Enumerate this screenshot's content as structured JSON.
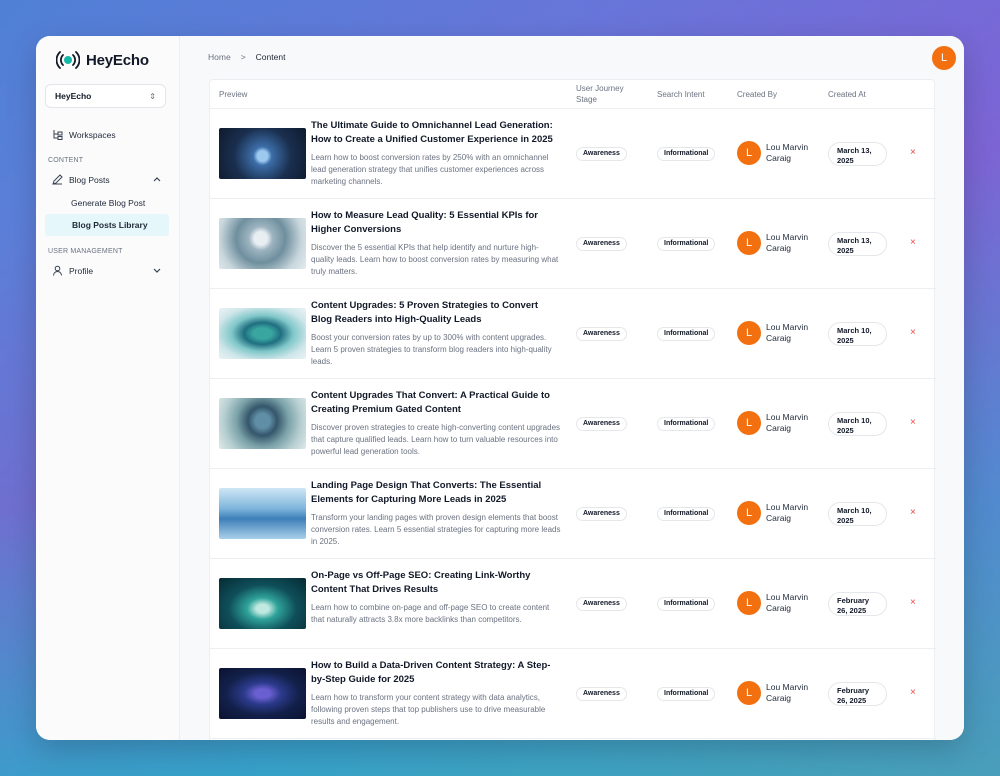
{
  "app": {
    "name": "HeyEcho",
    "brand_color": "#16b8a6",
    "accent_color": "#f2700f"
  },
  "sidebar": {
    "workspace_select": "HeyEcho",
    "workspaces_label": "Workspaces",
    "content_section": "CONTENT",
    "blog_posts_label": "Blog Posts",
    "generate_label": "Generate Blog Post",
    "library_label": "Blog Posts Library",
    "user_section": "USER MANAGEMENT",
    "profile_label": "Profile"
  },
  "breadcrumb": {
    "home": "Home",
    "separator": ">",
    "current": "Content"
  },
  "user_avatar": "L",
  "table": {
    "headers": {
      "preview": "Preview",
      "stage": "User Journey Stage",
      "intent": "Search Intent",
      "created_by": "Created By",
      "created_at": "Created At"
    },
    "rows": [
      {
        "title": "The Ultimate Guide to Omnichannel Lead Generation: How to Create a Unified Customer Experience in 2025",
        "desc": "Learn how to boost conversion rates by 250% with an omnichannel lead generation strategy that unifies customer experiences across marketing channels.",
        "stage": "Awareness",
        "intent": "Informational",
        "avatar": "L",
        "author": "Lou Marvin Caraig",
        "date": "March 13, 2025",
        "delete": "×"
      },
      {
        "title": "How to Measure Lead Quality: 5 Essential KPIs for Higher Conversions",
        "desc": "Discover the 5 essential KPIs that help identify and nurture high-quality leads. Learn how to boost conversion rates by measuring what truly matters.",
        "stage": "Awareness",
        "intent": "Informational",
        "avatar": "L",
        "author": "Lou Marvin Caraig",
        "date": "March 13, 2025",
        "delete": "×"
      },
      {
        "title": "Content Upgrades: 5 Proven Strategies to Convert Blog Readers into High-Quality Leads",
        "desc": "Boost your conversion rates by up to 300% with content upgrades. Learn 5 proven strategies to transform blog readers into high-quality leads.",
        "stage": "Awareness",
        "intent": "Informational",
        "avatar": "L",
        "author": "Lou Marvin Caraig",
        "date": "March 10, 2025",
        "delete": "×"
      },
      {
        "title": "Content Upgrades That Convert: A Practical Guide to Creating Premium Gated Content",
        "desc": "Discover proven strategies to create high-converting content upgrades that capture qualified leads. Learn how to turn valuable resources into powerful lead generation tools.",
        "stage": "Awareness",
        "intent": "Informational",
        "avatar": "L",
        "author": "Lou Marvin Caraig",
        "date": "March 10, 2025",
        "delete": "×"
      },
      {
        "title": "Landing Page Design That Converts: The Essential Elements for Capturing More Leads in 2025",
        "desc": "Transform your landing pages with proven design elements that boost conversion rates. Learn 5 essential strategies for capturing more leads in 2025.",
        "stage": "Awareness",
        "intent": "Informational",
        "avatar": "L",
        "author": "Lou Marvin Caraig",
        "date": "March 10, 2025",
        "delete": "×"
      },
      {
        "title": "On-Page vs Off-Page SEO: Creating Link-Worthy Content That Drives Results",
        "desc": "Learn how to combine on-page and off-page SEO to create content that naturally attracts 3.8x more backlinks than competitors.",
        "stage": "Awareness",
        "intent": "Informational",
        "avatar": "L",
        "author": "Lou Marvin Caraig",
        "date": "February 26, 2025",
        "delete": "×"
      },
      {
        "title": "How to Build a Data-Driven Content Strategy: A Step-by-Step Guide for 2025",
        "desc": "Learn how to transform your content strategy with data analytics, following proven steps that top publishers use to drive measurable results and engagement.",
        "stage": "Awareness",
        "intent": "Informational",
        "avatar": "L",
        "author": "Lou Marvin Caraig",
        "date": "February 26, 2025",
        "delete": "×"
      }
    ]
  }
}
